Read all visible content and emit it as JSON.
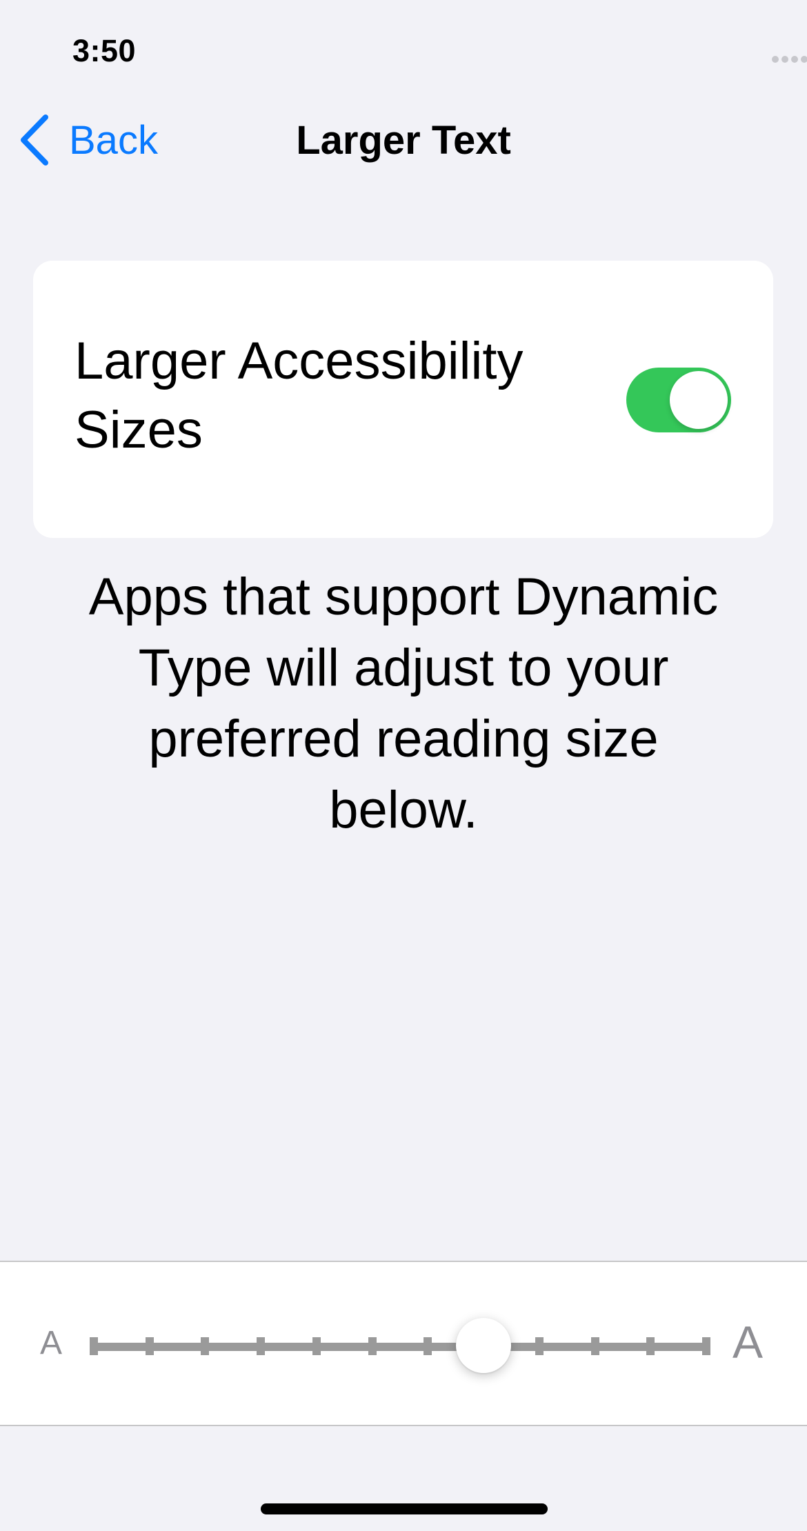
{
  "status_bar": {
    "time": "3:50",
    "icons": [
      "signal-icon",
      "wifi-icon",
      "battery-icon"
    ]
  },
  "nav": {
    "back_label": "Back",
    "title": "Larger Text"
  },
  "accessibility_toggle": {
    "label": "Larger Accessibility Sizes",
    "on": true
  },
  "description": "Apps that support Dynamic Type will adjust to your preferred reading size below.",
  "text_size_slider": {
    "min_label": "A",
    "max_label": "A",
    "steps": 12,
    "selected_index": 7
  },
  "colors": {
    "accent": "#0a7aff",
    "toggle_on": "#34c759",
    "background": "#f2f2f7",
    "secondary": "#8e8e93"
  }
}
